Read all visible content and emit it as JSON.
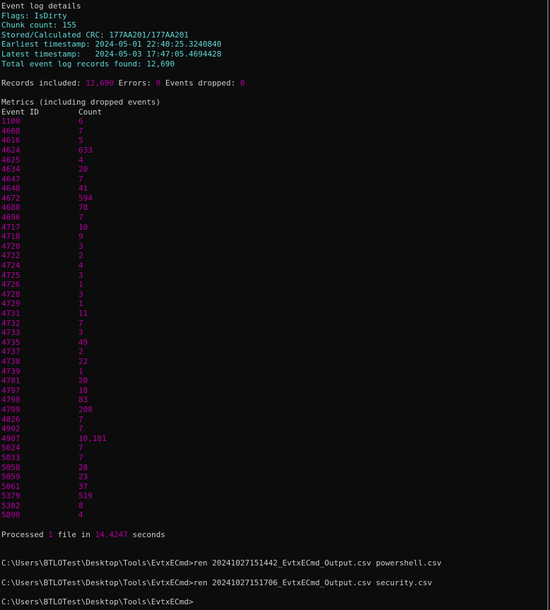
{
  "details": {
    "title": "Event log details",
    "flags": "Flags: IsDirty",
    "chunk_count": "Chunk count: 155",
    "crc": "Stored/Calculated CRC: 177AA201/177AA201",
    "earliest": "Earliest timestamp: 2024-05-01 22:40:25.3240840",
    "latest": "Latest timestamp:   2024-05-03 17:47:05.4694428",
    "total": "Total event log records found: 12,690"
  },
  "summary": {
    "records_label": "Records included: ",
    "records_value": "12,690",
    "errors_label": " Errors: ",
    "errors_value": "0",
    "dropped_label": " Events dropped: ",
    "dropped_value": "0"
  },
  "metrics": {
    "title": "Metrics (including dropped events)",
    "header_id": "Event ID",
    "header_count": "Count",
    "rows": [
      {
        "id": "1100",
        "count": "6"
      },
      {
        "id": "4608",
        "count": "7"
      },
      {
        "id": "4616",
        "count": "5"
      },
      {
        "id": "4624",
        "count": "633"
      },
      {
        "id": "4625",
        "count": "4"
      },
      {
        "id": "4634",
        "count": "20"
      },
      {
        "id": "4647",
        "count": "7"
      },
      {
        "id": "4648",
        "count": "41"
      },
      {
        "id": "4672",
        "count": "594"
      },
      {
        "id": "4688",
        "count": "78"
      },
      {
        "id": "4696",
        "count": "7"
      },
      {
        "id": "4717",
        "count": "10"
      },
      {
        "id": "4718",
        "count": "9"
      },
      {
        "id": "4720",
        "count": "3"
      },
      {
        "id": "4722",
        "count": "2"
      },
      {
        "id": "4724",
        "count": "4"
      },
      {
        "id": "4725",
        "count": "3"
      },
      {
        "id": "4726",
        "count": "1"
      },
      {
        "id": "4728",
        "count": "3"
      },
      {
        "id": "4729",
        "count": "1"
      },
      {
        "id": "4731",
        "count": "11"
      },
      {
        "id": "4732",
        "count": "7"
      },
      {
        "id": "4733",
        "count": "3"
      },
      {
        "id": "4735",
        "count": "49"
      },
      {
        "id": "4737",
        "count": "2"
      },
      {
        "id": "4738",
        "count": "22"
      },
      {
        "id": "4739",
        "count": "1"
      },
      {
        "id": "4781",
        "count": "20"
      },
      {
        "id": "4797",
        "count": "18"
      },
      {
        "id": "4798",
        "count": "83"
      },
      {
        "id": "4799",
        "count": "208"
      },
      {
        "id": "4826",
        "count": "7"
      },
      {
        "id": "4902",
        "count": "7"
      },
      {
        "id": "4907",
        "count": "10,181"
      },
      {
        "id": "5024",
        "count": "7"
      },
      {
        "id": "5033",
        "count": "7"
      },
      {
        "id": "5058",
        "count": "28"
      },
      {
        "id": "5059",
        "count": "23"
      },
      {
        "id": "5061",
        "count": "37"
      },
      {
        "id": "5379",
        "count": "519"
      },
      {
        "id": "5382",
        "count": "8"
      },
      {
        "id": "5890",
        "count": "4"
      }
    ]
  },
  "processed": {
    "prefix": "Processed ",
    "files": "1",
    "middle": " file in ",
    "seconds": "14.4247",
    "suffix": " seconds"
  },
  "commands": [
    "C:\\Users\\BTLOTest\\Desktop\\Tools\\EvtxECmd>ren 20241027151442_EvtxECmd_Output.csv powershell.csv",
    "C:\\Users\\BTLOTest\\Desktop\\Tools\\EvtxECmd>ren 20241027151706_EvtxECmd_Output.csv security.csv",
    "C:\\Users\\BTLOTest\\Desktop\\Tools\\EvtxECmd>"
  ],
  "colors": {
    "background": "#0c0c0c",
    "text": "#cccccc",
    "cyan": "#61d6d6",
    "magenta": "#b4009e"
  }
}
